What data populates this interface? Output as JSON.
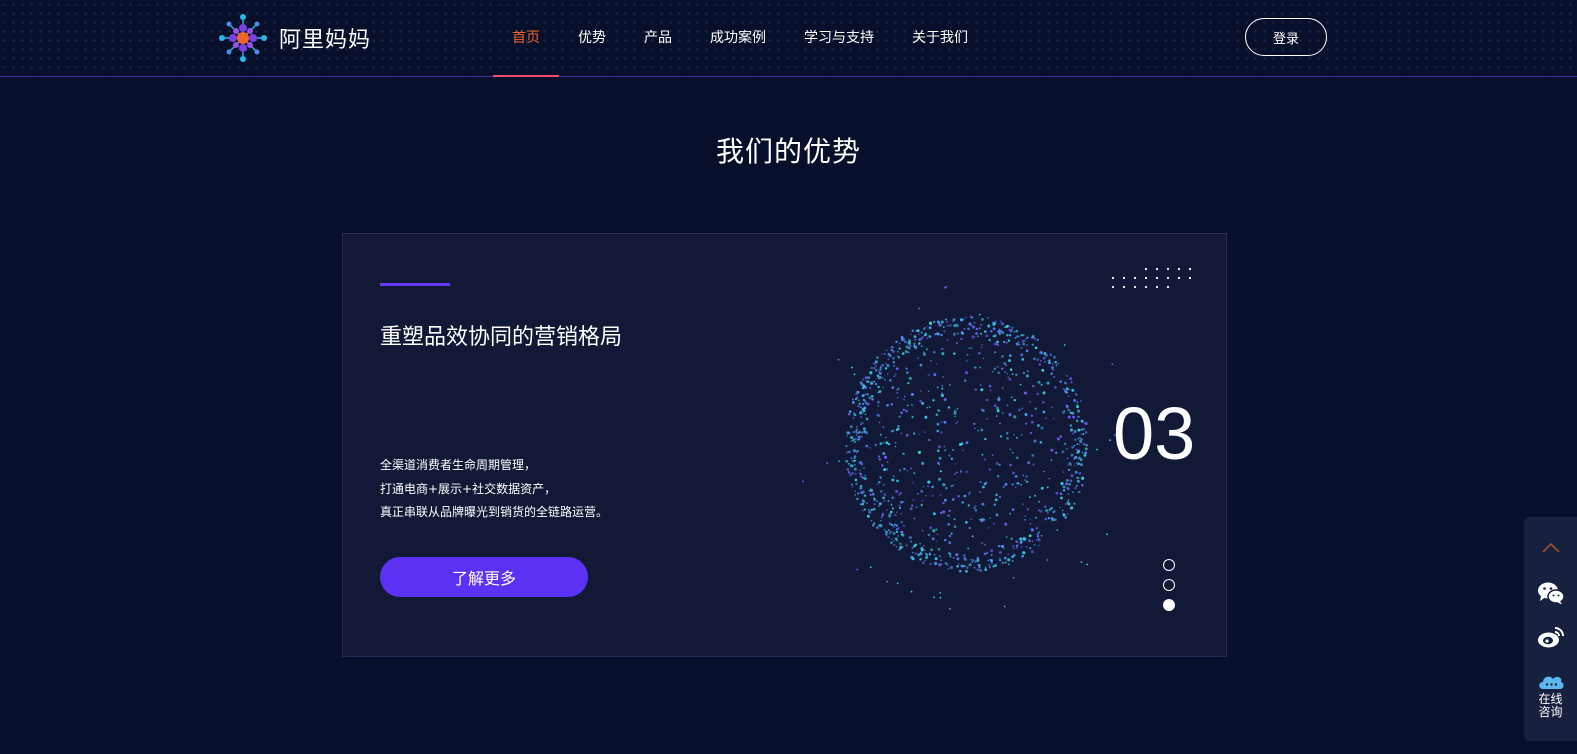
{
  "brand": {
    "name": "阿里妈妈",
    "logo_icon": "alimama-logo-icon"
  },
  "nav": {
    "items": [
      {
        "label": "首页",
        "active": true
      },
      {
        "label": "优势",
        "active": false
      },
      {
        "label": "产品",
        "active": false
      },
      {
        "label": "成功案例",
        "active": false
      },
      {
        "label": "学习与支持",
        "active": false
      },
      {
        "label": "关于我们",
        "active": false
      }
    ],
    "login_label": "登录"
  },
  "section": {
    "title": "我们的优势"
  },
  "slide": {
    "title": "重塑品效协同的营销格局",
    "desc_lines": [
      "全渠道消费者生命周期管理，",
      "打通电商+展示+社交数据资产，",
      "真正串联从品牌曝光到销货的全链路运营。"
    ],
    "button_label": "了解更多",
    "number": "03",
    "pager": {
      "count": 3,
      "current": 3
    }
  },
  "side_bar": {
    "consult_label_line1": "在线",
    "consult_label_line2": "咨询",
    "icons": [
      "chevron-up-icon",
      "wechat-icon",
      "weibo-icon",
      "cloud-chat-icon"
    ]
  },
  "colors": {
    "background": "#07102a",
    "card": "#111937",
    "accent": "#5b32f4",
    "nav_active": "#f2642b"
  }
}
